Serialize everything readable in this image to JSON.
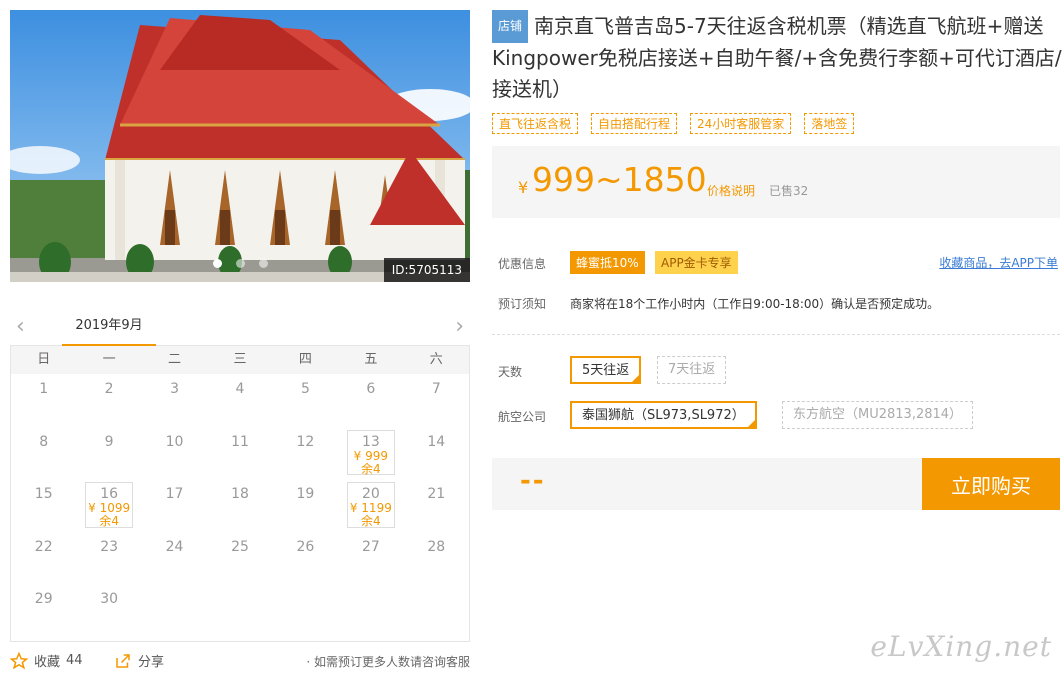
{
  "hero": {
    "image_id": "ID:5705113",
    "slide_count": 3,
    "active_slide": 0
  },
  "calendar": {
    "month_label": "2019年9月",
    "weekdays": [
      "日",
      "一",
      "二",
      "三",
      "四",
      "五",
      "六"
    ],
    "first_weekday_index": 0,
    "days": [
      {
        "d": "1"
      },
      {
        "d": "2"
      },
      {
        "d": "3"
      },
      {
        "d": "4"
      },
      {
        "d": "5"
      },
      {
        "d": "6"
      },
      {
        "d": "7"
      },
      {
        "d": "8"
      },
      {
        "d": "9"
      },
      {
        "d": "10"
      },
      {
        "d": "11"
      },
      {
        "d": "12"
      },
      {
        "d": "13",
        "price": "¥ 999",
        "stock": "余4"
      },
      {
        "d": "14"
      },
      {
        "d": "15"
      },
      {
        "d": "16",
        "price": "¥ 1099",
        "stock": "余4"
      },
      {
        "d": "17"
      },
      {
        "d": "18"
      },
      {
        "d": "19"
      },
      {
        "d": "20",
        "price": "¥ 1199",
        "stock": "余4"
      },
      {
        "d": "21"
      },
      {
        "d": "22"
      },
      {
        "d": "23"
      },
      {
        "d": "24"
      },
      {
        "d": "25"
      },
      {
        "d": "26"
      },
      {
        "d": "27"
      },
      {
        "d": "28"
      },
      {
        "d": "29"
      },
      {
        "d": "30"
      }
    ]
  },
  "bottom": {
    "fav_label": "收藏",
    "fav_count": "44",
    "share_label": "分享",
    "more_note": "· 如需预订更多人数请咨询客服"
  },
  "product": {
    "shop_badge": "店铺",
    "title": "南京直飞普吉岛5-7天往返含税机票（精选直飞航班+赠送Kingpower免税店接送+自助午餐/+含免费行李额+可代订酒店/接送机）",
    "tags": [
      "直飞往返含税",
      "自由搭配行程",
      "24小时客服管家",
      "落地签"
    ]
  },
  "price": {
    "currency": "¥",
    "range": "999~1850",
    "explain": "价格说明",
    "sold": "已售32"
  },
  "promo": {
    "label": "优惠信息",
    "badge1": "蜂蜜抵10%",
    "badge2": "APP金卡专享",
    "fav_app": "收藏商品，去APP下单"
  },
  "notice": {
    "label": "预订须知",
    "text": "商家将在18个工作小时内（工作日9:00-18:00）确认是否预定成功。"
  },
  "options": {
    "days_label": "天数",
    "days": [
      "5天往返",
      "7天往返"
    ],
    "airline_label": "航空公司",
    "airlines": [
      "泰国狮航（SL973,SL972）",
      "东方航空（MU2813,2814）"
    ]
  },
  "buy": {
    "total": "--",
    "button": "立即购买"
  },
  "watermark": "eLvXing.net",
  "colors": {
    "accent": "#f39800",
    "link": "#3a7bd5",
    "badge": "#5b9bd5"
  }
}
